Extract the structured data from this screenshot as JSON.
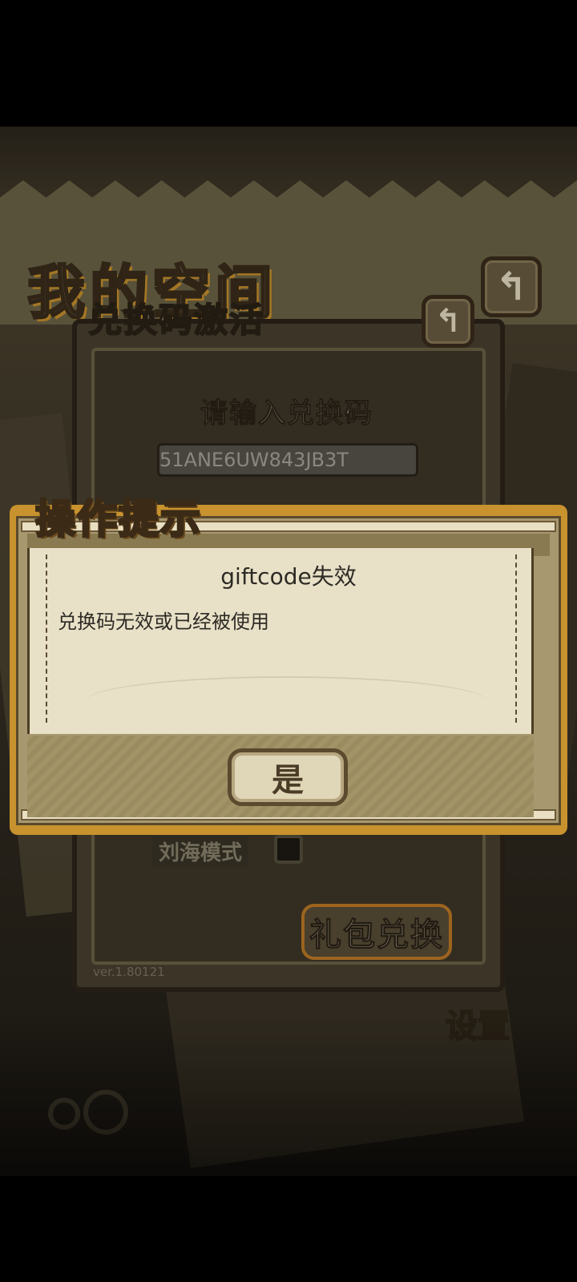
{
  "background": {
    "title": "我的空间",
    "settings_label": "设置",
    "back_icon": "back-arrow-icon"
  },
  "redeem_panel": {
    "title": "兑换码激活",
    "prompt": "请输入兑换码",
    "code_value": "51ANE6UW843JB3T",
    "notch_mode_label": "刘海模式",
    "notch_mode_checked": false,
    "gift_redeem_label": "礼包兑换",
    "version": "ver.1.80121"
  },
  "dialog": {
    "title": "操作提示",
    "heading": "giftcode失效",
    "message": "兑换码无效或已经被使用",
    "ok_label": "是"
  },
  "colors": {
    "accent_orange": "#c8922e",
    "paper": "#e8e1c8",
    "dark_brown": "#3b2a16"
  }
}
